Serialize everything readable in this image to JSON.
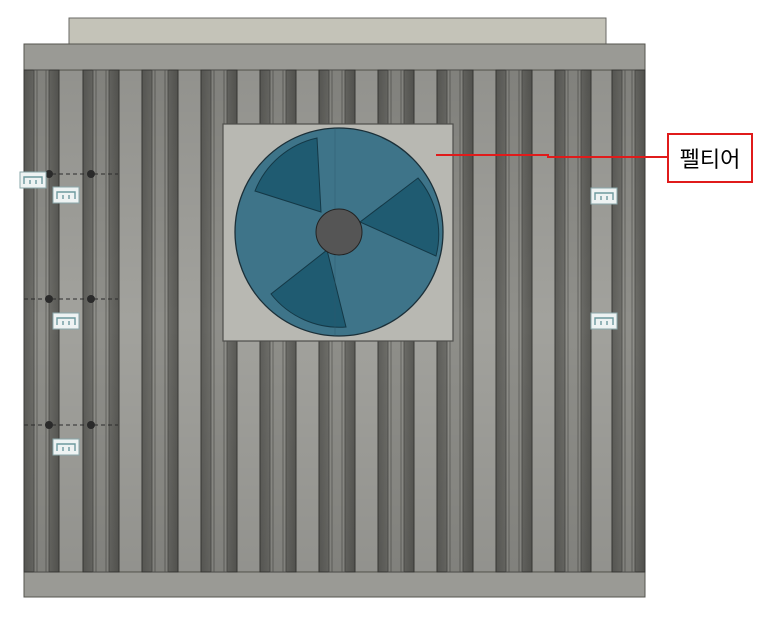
{
  "scene": {
    "description_free": true,
    "colors": {
      "background": "#ffffff",
      "heatsink_body": "#9c9c97",
      "heatsink_dark": "#6f6f6b",
      "top_plate": "#c4c3b8",
      "fan_mount_plate": "#b7b7b1",
      "fan_disc": "#3d7188",
      "fan_blade": "#1f5b71",
      "fan_hub": "#545454",
      "marker_glyph": "#9fc0c2",
      "callout_line": "#e01b1b",
      "callout_border": "#e01b1b"
    },
    "icons": {
      "fan": "fan-icon",
      "sketch_point": "sketch-point-icon",
      "constraint_marker": "constraint-marker-icon"
    }
  },
  "callout": {
    "label": "펠티어"
  }
}
